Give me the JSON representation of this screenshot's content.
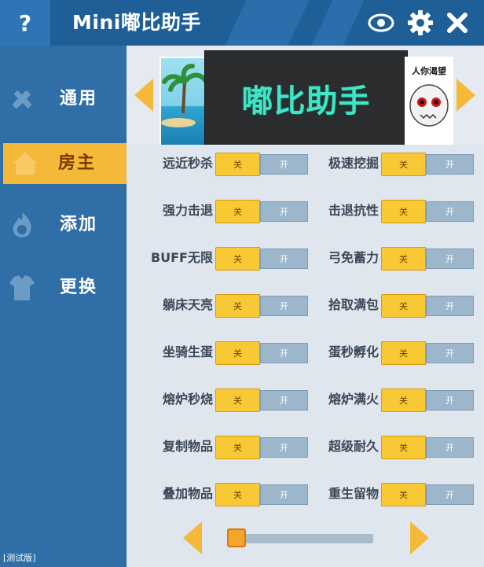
{
  "header": {
    "help_label": "?",
    "title": "Mini嘟比助手",
    "icons": [
      "eye-icon",
      "gear-icon",
      "close-icon"
    ]
  },
  "sidebar": {
    "items": [
      {
        "label": "通用",
        "icon": "wrench-pencil-icon",
        "active": false
      },
      {
        "label": "房主",
        "icon": "house-icon",
        "active": true
      },
      {
        "label": "添加",
        "icon": "plus-flame-icon",
        "active": false
      },
      {
        "label": "更换",
        "icon": "shirt-icon",
        "active": false
      }
    ],
    "version_label": "[测试版]"
  },
  "banner": {
    "main_text": "嘟比助手",
    "right_caption": "人你渴望"
  },
  "features": [
    {
      "label": "远近秒杀",
      "off": "关",
      "on": "开",
      "state": "off"
    },
    {
      "label": "极速挖掘",
      "off": "关",
      "on": "开",
      "state": "off"
    },
    {
      "label": "强力击退",
      "off": "关",
      "on": "开",
      "state": "off"
    },
    {
      "label": "击退抗性",
      "off": "关",
      "on": "开",
      "state": "off"
    },
    {
      "label": "BUFF无限",
      "off": "关",
      "on": "开",
      "state": "off"
    },
    {
      "label": "弓免蓄力",
      "off": "关",
      "on": "开",
      "state": "off"
    },
    {
      "label": "躺床天亮",
      "off": "关",
      "on": "开",
      "state": "off"
    },
    {
      "label": "拾取满包",
      "off": "关",
      "on": "开",
      "state": "off"
    },
    {
      "label": "坐骑生蛋",
      "off": "关",
      "on": "开",
      "state": "off"
    },
    {
      "label": "蛋秒孵化",
      "off": "关",
      "on": "开",
      "state": "off"
    },
    {
      "label": "熔炉秒烧",
      "off": "关",
      "on": "开",
      "state": "off"
    },
    {
      "label": "熔炉满火",
      "off": "关",
      "on": "开",
      "state": "off"
    },
    {
      "label": "复制物品",
      "off": "关",
      "on": "开",
      "state": "off"
    },
    {
      "label": "超级耐久",
      "off": "关",
      "on": "开",
      "state": "off"
    },
    {
      "label": "叠加物品",
      "off": "关",
      "on": "开",
      "state": "off"
    },
    {
      "label": "重生留物",
      "off": "关",
      "on": "开",
      "state": "off"
    }
  ],
  "pager": {
    "position_fraction": 0.0
  },
  "colors": {
    "header": "#1f5f98",
    "sidebar": "#2f6ea6",
    "accent": "#f5b93a",
    "panel": "#dfe6ee"
  }
}
